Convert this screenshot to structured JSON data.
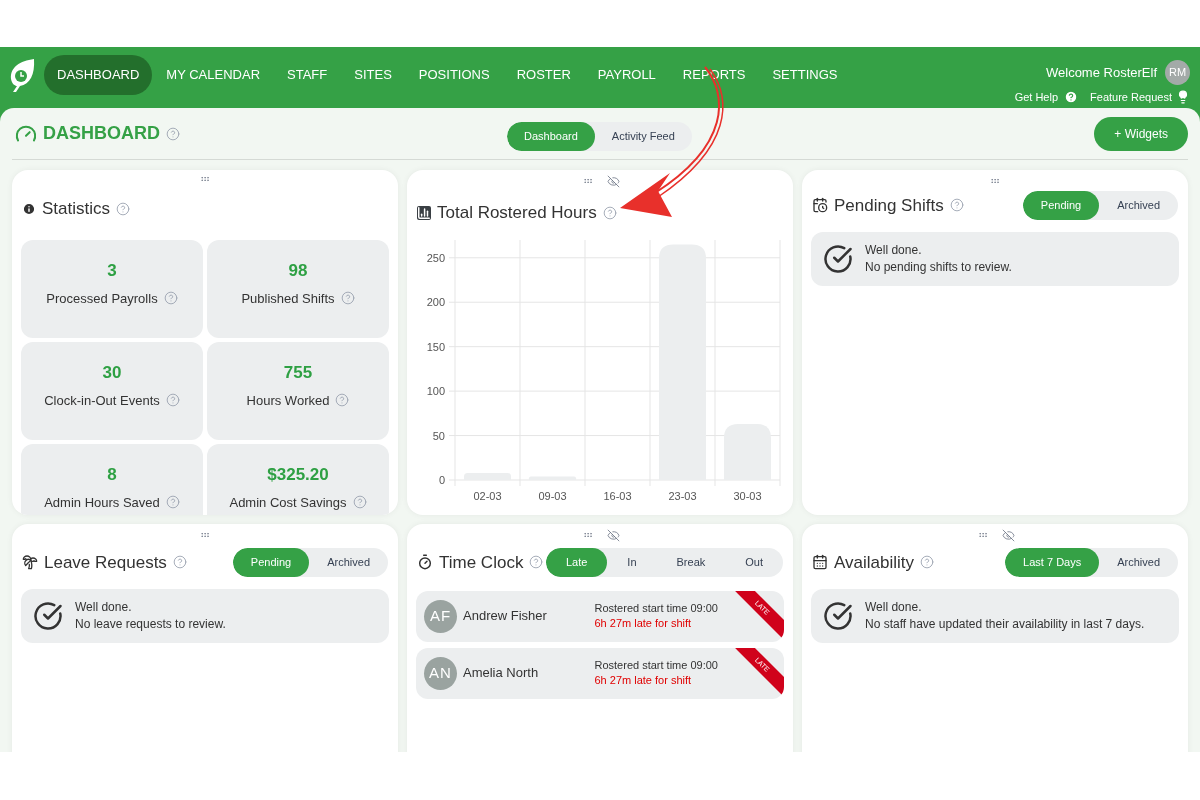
{
  "nav": {
    "items": [
      {
        "label": "DASHBOARD",
        "selected": true
      },
      {
        "label": "MY CALENDAR",
        "selected": false
      },
      {
        "label": "STAFF",
        "selected": false
      },
      {
        "label": "SITES",
        "selected": false
      },
      {
        "label": "POSITIONS",
        "selected": false
      },
      {
        "label": "ROSTER",
        "selected": false
      },
      {
        "label": "PAYROLL",
        "selected": false
      },
      {
        "label": "REPORTS",
        "selected": false
      },
      {
        "label": "SETTINGS",
        "selected": false
      }
    ],
    "welcome": "Welcome RosterElf",
    "avatar": "RM",
    "help": "Get Help",
    "feature": "Feature Request"
  },
  "page": {
    "title": "DASHBOARD",
    "tabs": [
      {
        "label": "Dashboard",
        "selected": true
      },
      {
        "label": "Activity Feed",
        "selected": false
      }
    ],
    "add_button": "+ Widgets"
  },
  "statistics": {
    "title": "Statistics",
    "stats": [
      {
        "value": "3",
        "label": "Processed Payrolls"
      },
      {
        "value": "98",
        "label": "Published Shifts"
      },
      {
        "value": "30",
        "label": "Clock-in-Out Events"
      },
      {
        "value": "755",
        "label": "Hours Worked"
      },
      {
        "value": "8",
        "label": "Admin Hours Saved"
      },
      {
        "value": "$325.20",
        "label": "Admin Cost Savings"
      }
    ]
  },
  "rostered_hours": {
    "title": "Total Rostered Hours",
    "hide_toggle": true,
    "chart_data": {
      "type": "bar",
      "categories": [
        "02-03",
        "09-03",
        "16-03",
        "23-03",
        "30-03"
      ],
      "values": [
        8,
        4,
        0,
        265,
        63
      ],
      "ylim": [
        0,
        270
      ],
      "grid": true,
      "yticks": [
        0,
        50,
        100,
        150,
        200,
        250
      ]
    }
  },
  "pending_shifts": {
    "title": "Pending Shifts",
    "tabs": [
      {
        "label": "Pending",
        "selected": true
      },
      {
        "label": "Archived",
        "selected": false
      }
    ],
    "message": {
      "title": "Well done.",
      "text": "No pending shifts to review."
    }
  },
  "leave_requests": {
    "title": "Leave Requests",
    "tabs": [
      {
        "label": "Pending",
        "selected": true
      },
      {
        "label": "Archived",
        "selected": false
      }
    ],
    "message": {
      "title": "Well done.",
      "text": "No leave requests to review."
    }
  },
  "time_clock": {
    "title": "Time Clock",
    "hide_toggle": true,
    "tabs": [
      {
        "label": "Late",
        "selected": true
      },
      {
        "label": "In",
        "selected": false
      },
      {
        "label": "Break",
        "selected": false
      },
      {
        "label": "Out",
        "selected": false
      }
    ],
    "entries": [
      {
        "initials": "AF",
        "name": "Andrew Fisher",
        "rostered": "Rostered start time 09:00",
        "late": "6h 27m late for shift",
        "badge": "LATE"
      },
      {
        "initials": "AN",
        "name": "Amelia North",
        "rostered": "Rostered start time 09:00",
        "late": "6h 27m late for shift",
        "badge": "LATE"
      }
    ]
  },
  "availability": {
    "title": "Availability",
    "hide_toggle": true,
    "tabs": [
      {
        "label": "Last 7 Days",
        "selected": true
      },
      {
        "label": "Archived",
        "selected": false
      }
    ],
    "message": {
      "title": "Well done.",
      "text": "No staff have updated their availability in last 7 days."
    }
  }
}
